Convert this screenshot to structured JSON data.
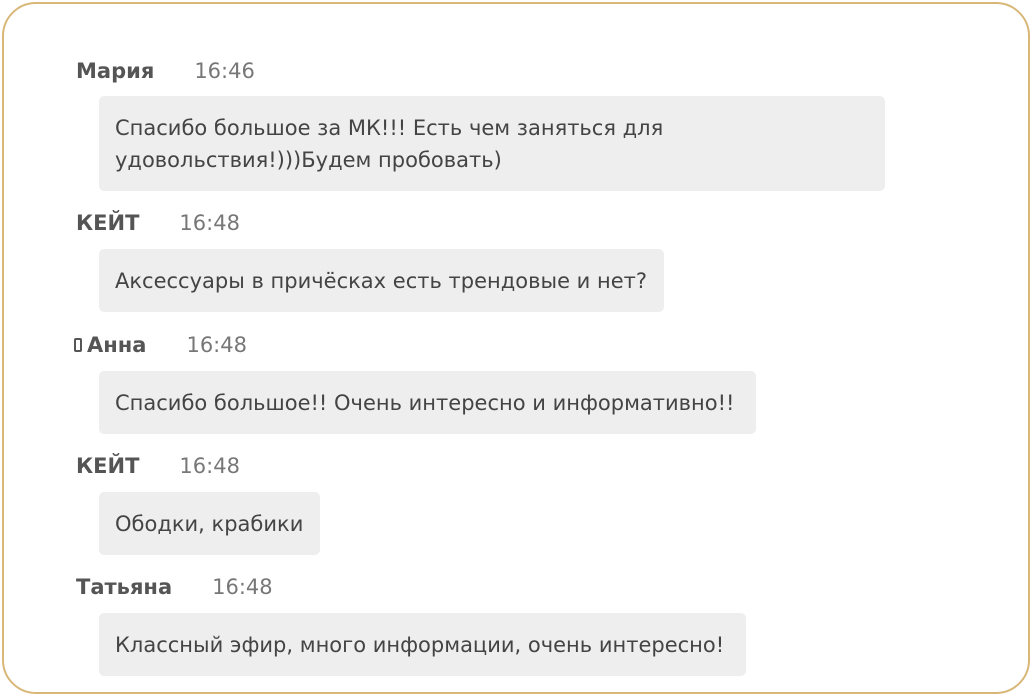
{
  "messages": [
    {
      "author": "Мария",
      "time": "16:46",
      "text_lines": [
        "Спасибо большое за МК!!! Есть чем заняться для",
        "удовольствия!)))Будем пробовать)"
      ],
      "mobile": false
    },
    {
      "author": "КЕЙТ",
      "time": "16:48",
      "text_lines": [
        "Аксессуары в причёсках есть трендовые и нет?"
      ],
      "mobile": false
    },
    {
      "author": "Анна",
      "time": "16:48",
      "text_lines": [
        "Спасибо большое!! Очень интересно и информативно!!"
      ],
      "mobile": true
    },
    {
      "author": "КЕЙТ",
      "time": "16:48",
      "text_lines": [
        "Ободки, крабики"
      ],
      "mobile": false
    },
    {
      "author": "Татьяна",
      "time": "16:48",
      "text_lines": [
        "Классный эфир, много информации, очень интересно!"
      ],
      "mobile": false
    }
  ],
  "colors": {
    "frame_border": "#d8b778",
    "bubble_bg": "#eeeeee",
    "author_text": "#555555",
    "time_text": "#777777",
    "message_text": "#444444"
  },
  "icons": {
    "mobile": "mobile-phone-icon"
  }
}
